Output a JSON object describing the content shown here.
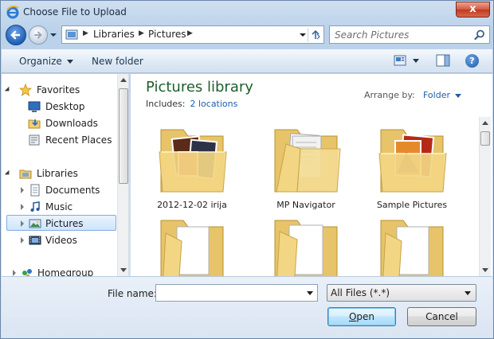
{
  "window": {
    "title": "Choose File to Upload",
    "close_label": "x"
  },
  "navbar": {
    "breadcrumbs": [
      "Libraries",
      "Pictures"
    ],
    "search_placeholder": "Search Pictures"
  },
  "toolbar": {
    "organize_label": "Organize",
    "new_folder_label": "New folder",
    "help_label": "?"
  },
  "navpane": {
    "favorites": {
      "label": "Favorites",
      "items": [
        {
          "label": "Desktop",
          "icon": "desktop-icon"
        },
        {
          "label": "Downloads",
          "icon": "downloads-icon"
        },
        {
          "label": "Recent Places",
          "icon": "recent-places-icon"
        }
      ]
    },
    "libraries": {
      "label": "Libraries",
      "items": [
        {
          "label": "Documents",
          "icon": "documents-icon"
        },
        {
          "label": "Music",
          "icon": "music-icon"
        },
        {
          "label": "Pictures",
          "icon": "pictures-icon",
          "selected": true
        },
        {
          "label": "Videos",
          "icon": "videos-icon"
        }
      ]
    },
    "homegroup": {
      "label": "Homegroup"
    }
  },
  "content": {
    "title": "Pictures library",
    "includes_label": "Includes:",
    "locations_link": "2 locations",
    "arrange_label": "Arrange by:",
    "arrange_value": "Folder",
    "folders": [
      {
        "label": "2012-12-02 irija",
        "thumb": "photos"
      },
      {
        "label": "MP Navigator",
        "thumb": "documents"
      },
      {
        "label": "Sample Pictures",
        "thumb": "samples"
      },
      {
        "label": "",
        "thumb": "empty"
      },
      {
        "label": "",
        "thumb": "empty"
      },
      {
        "label": "",
        "thumb": "empty"
      }
    ]
  },
  "bottom": {
    "filename_label": "File name:",
    "filename_value": "",
    "filter_value": "All Files (*.*)",
    "open_label": "pen",
    "open_accel": "O",
    "cancel_label": "Cancel"
  },
  "colors": {
    "title_green": "#1e5e2a",
    "link_blue": "#1f5ea8",
    "selection_bg": "#cfe5fb",
    "folder_yellow": "#f3d684"
  }
}
